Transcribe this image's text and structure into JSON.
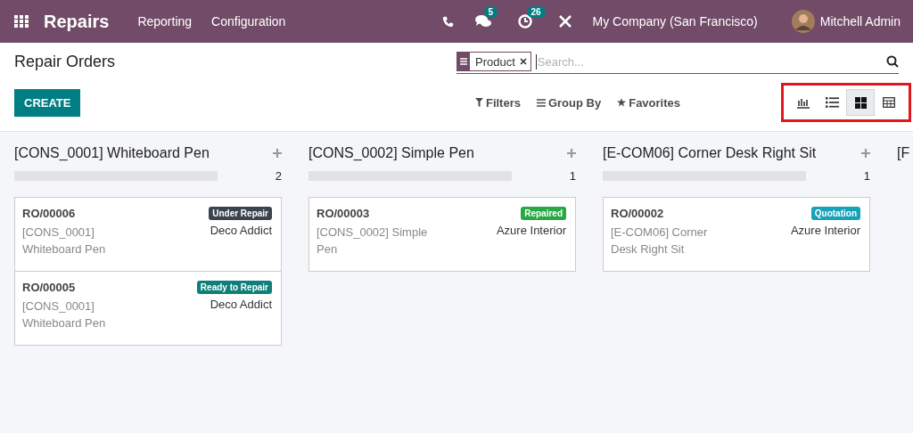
{
  "navbar": {
    "app_name": "Repairs",
    "menus": [
      "Reporting",
      "Configuration"
    ],
    "chat_badge": "5",
    "activity_badge": "26",
    "company": "My Company (San Francisco)",
    "user": "Mitchell Admin"
  },
  "control_panel": {
    "title": "Repair Orders",
    "create_label": "CREATE",
    "search_facet": "Product",
    "search_placeholder": "Search...",
    "filters": "Filters",
    "group_by": "Group By",
    "favorites": "Favorites",
    "views_highlighted": true,
    "views": [
      {
        "kind": "graph",
        "selected": false
      },
      {
        "kind": "list",
        "selected": false
      },
      {
        "kind": "kanban",
        "selected": true
      },
      {
        "kind": "pivot",
        "selected": false
      }
    ]
  },
  "columns": [
    {
      "title": "[CONS_0001] Whiteboard Pen",
      "count": "2",
      "level": 0,
      "cards": [
        {
          "ref": "RO/00006",
          "status": "Under Repair",
          "color": "#3a4350",
          "product": "[CONS_0001] Whiteboard Pen",
          "customer": "Deco Addict"
        },
        {
          "ref": "RO/00005",
          "status": "Ready to Repair",
          "color": "#0f7f7b",
          "product": "[CONS_0001] Whiteboard Pen",
          "customer": "Deco Addict"
        }
      ]
    },
    {
      "title": "[CONS_0002] Simple Pen",
      "count": "1",
      "level": 0,
      "cards": [
        {
          "ref": "RO/00003",
          "status": "Repaired",
          "color": "#28a745",
          "product": "[CONS_0002] Simple Pen",
          "customer": "Azure Interior"
        }
      ]
    },
    {
      "title": "[E-COM06] Corner Desk Right Sit",
      "count": "1",
      "level": 0,
      "cards": [
        {
          "ref": "RO/00002",
          "status": "Quotation",
          "color": "#17a2b8",
          "product": "[E-COM06] Corner Desk Right Sit",
          "customer": "Azure Interior"
        }
      ]
    },
    {
      "title": "[F"
    }
  ]
}
